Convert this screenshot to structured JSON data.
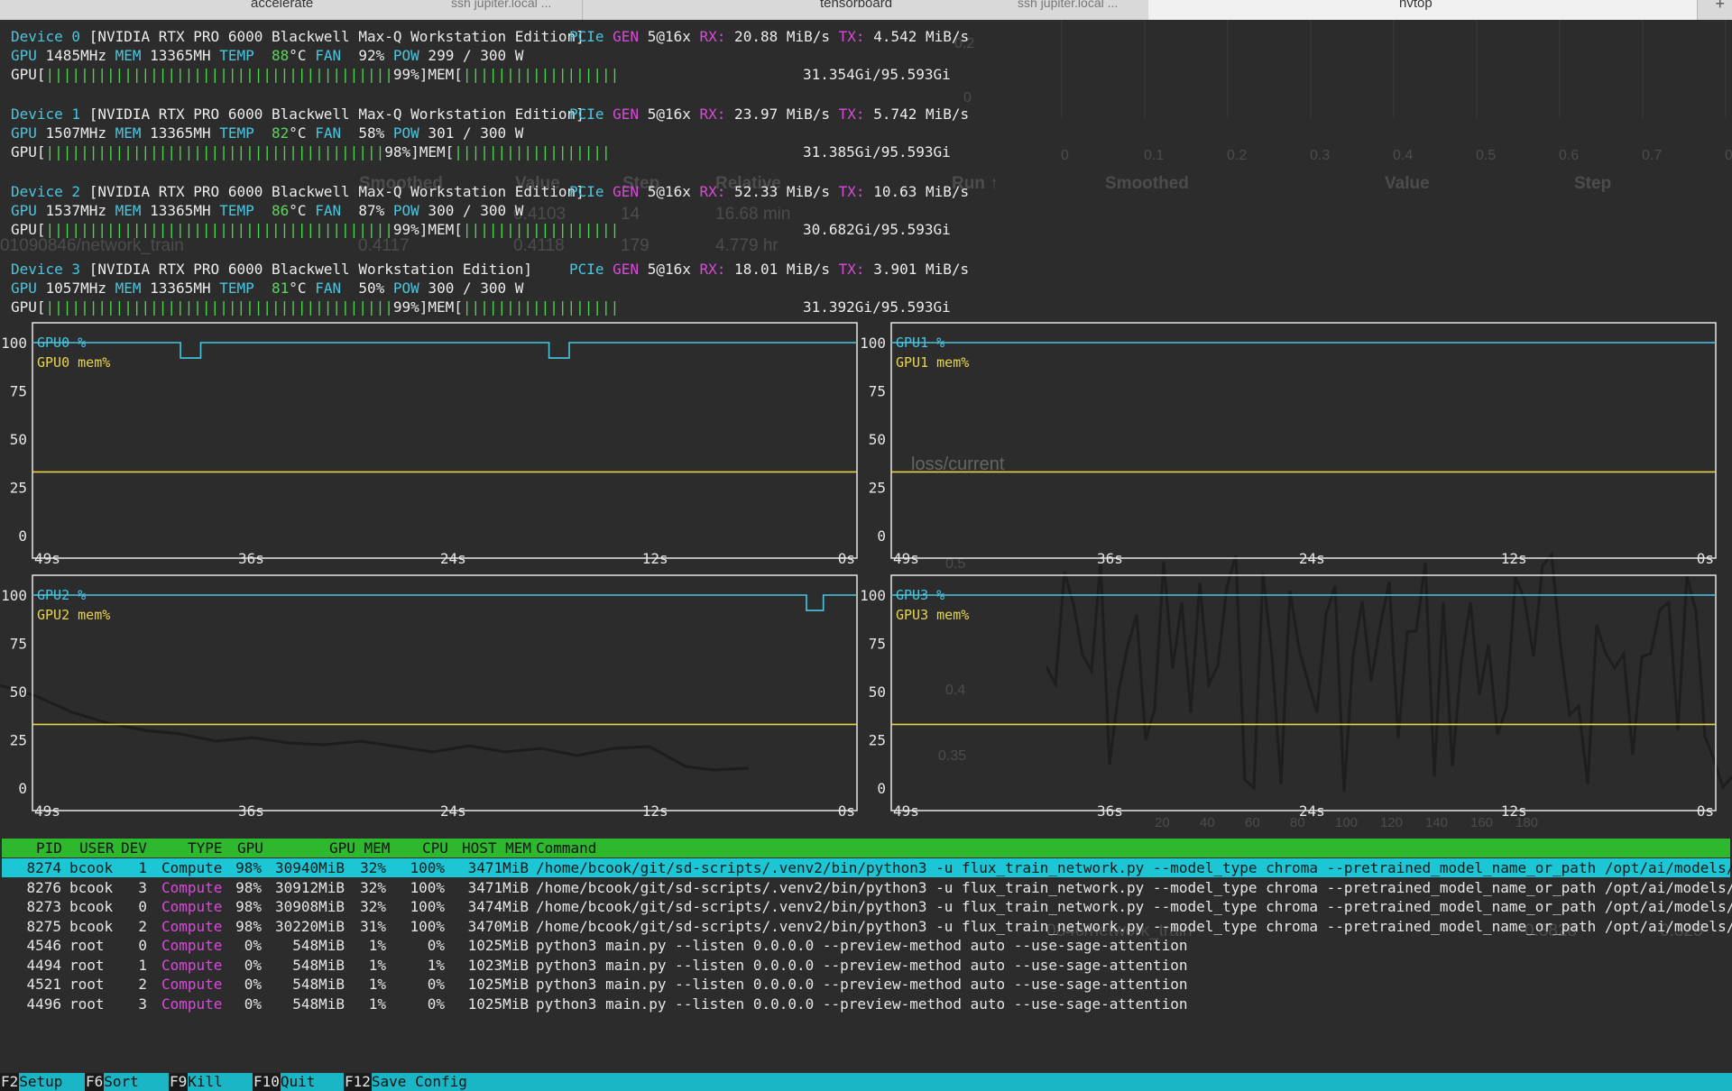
{
  "tabs": [
    {
      "title": "accelerate",
      "sub": "ssh jupiter.local ..."
    },
    {
      "title": "tensorboard",
      "sub": "ssh jupiter.local ..."
    },
    {
      "title": "nvtop",
      "sub": ""
    }
  ],
  "tab_plus": "+",
  "devices": [
    {
      "header": "Device 0",
      "name": "[NVIDIA RTX PRO 6000 Blackwell Max-Q Workstation Edition]",
      "pcie_gen": "5@16x",
      "rx": "20.88 MiB/s",
      "tx": "4.542 MiB/s",
      "gpu_clock": "1485MHz",
      "mem_clock": "13365MH",
      "temp": "88",
      "fan": "92%",
      "pow": "299 / 300 W",
      "util": "99%",
      "mem": "31.354Gi/95.593Gi"
    },
    {
      "header": "Device 1",
      "name": "[NVIDIA RTX PRO 6000 Blackwell Max-Q Workstation Edition]",
      "pcie_gen": "5@16x",
      "rx": "23.97 MiB/s",
      "tx": "5.742 MiB/s",
      "gpu_clock": "1507MHz",
      "mem_clock": "13365MH",
      "temp": "82",
      "fan": "58%",
      "pow": "301 / 300 W",
      "util": "98%",
      "mem": "31.385Gi/95.593Gi"
    },
    {
      "header": "Device 2",
      "name": "[NVIDIA RTX PRO 6000 Blackwell Max-Q Workstation Edition]",
      "pcie_gen": "5@16x",
      "rx": "52.33 MiB/s",
      "tx": "10.63 MiB/s",
      "gpu_clock": "1537MHz",
      "mem_clock": "13365MH",
      "temp": "86",
      "fan": "87%",
      "pow": "300 / 300 W",
      "util": "99%",
      "mem": "30.682Gi/95.593Gi"
    },
    {
      "header": "Device 3",
      "name": "[NVIDIA RTX PRO 6000 Blackwell Workstation Edition]",
      "pcie_gen": "5@16x",
      "rx": "18.01 MiB/s",
      "tx": "3.901 MiB/s",
      "gpu_clock": "1057MHz",
      "mem_clock": "13365MH",
      "temp": "81",
      "fan": "50%",
      "pow": "300 / 300 W",
      "util": "99%",
      "mem": "31.392Gi/95.593Gi"
    }
  ],
  "labels": {
    "pcie": "PCIe",
    "gen": "GEN",
    "rx": "RX:",
    "tx": "TX:",
    "gpu": "GPU",
    "mem": "MEM",
    "temp": "TEMP",
    "deg": "°C",
    "fan": "FAN",
    "pow": "POW",
    "gpu_bar_prefix": "GPU[",
    "mem_bar_prefix": "MEM[",
    "bar_suffix": "]"
  },
  "chart_data": [
    {
      "type": "line",
      "title": "",
      "legend": [
        "GPU0 %",
        "GPU0 mem%"
      ],
      "y_ticks": [
        "100",
        "75",
        "50",
        "25",
        "0"
      ],
      "x_ticks": [
        "49s",
        "36s",
        "24s",
        "12s",
        "0s"
      ],
      "ylim": [
        0,
        100
      ],
      "series": [
        {
          "name": "GPU0 %",
          "color": "#48c6e0",
          "x": [
            49,
            40.2,
            40.2,
            39,
            39,
            18.3,
            18.3,
            17.1,
            17.1,
            0
          ],
          "values": [
            100,
            100,
            92,
            92,
            100,
            100,
            92,
            92,
            100,
            100
          ]
        },
        {
          "name": "GPU0 mem%",
          "color": "#e8d44d",
          "x": [
            49,
            0
          ],
          "values": [
            33,
            33
          ]
        }
      ]
    },
    {
      "type": "line",
      "title": "",
      "legend": [
        "GPU1 %",
        "GPU1 mem%"
      ],
      "y_ticks": [
        "100",
        "75",
        "50",
        "25",
        "0"
      ],
      "x_ticks": [
        "49s",
        "36s",
        "24s",
        "12s",
        "0s"
      ],
      "ylim": [
        0,
        100
      ],
      "series": [
        {
          "name": "GPU1 %",
          "color": "#48c6e0",
          "x": [
            49,
            0
          ],
          "values": [
            100,
            100
          ]
        },
        {
          "name": "GPU1 mem%",
          "color": "#e8d44d",
          "x": [
            49,
            0
          ],
          "values": [
            33,
            33
          ]
        }
      ]
    },
    {
      "type": "line",
      "title": "",
      "legend": [
        "GPU2 %",
        "GPU2 mem%"
      ],
      "y_ticks": [
        "100",
        "75",
        "50",
        "25",
        "0"
      ],
      "x_ticks": [
        "49s",
        "36s",
        "24s",
        "12s",
        "0s"
      ],
      "ylim": [
        0,
        100
      ],
      "series": [
        {
          "name": "GPU2 %",
          "color": "#48c6e0",
          "x": [
            49,
            3,
            3,
            2,
            2,
            0
          ],
          "values": [
            100,
            100,
            92,
            92,
            100,
            100
          ]
        },
        {
          "name": "GPU2 mem%",
          "color": "#e8d44d",
          "x": [
            49,
            0
          ],
          "values": [
            33,
            33
          ]
        }
      ]
    },
    {
      "type": "line",
      "title": "",
      "legend": [
        "GPU3 %",
        "GPU3 mem%"
      ],
      "y_ticks": [
        "100",
        "75",
        "50",
        "25",
        "0"
      ],
      "x_ticks": [
        "49s",
        "36s",
        "24s",
        "12s",
        "0s"
      ],
      "ylim": [
        0,
        100
      ],
      "series": [
        {
          "name": "GPU3 %",
          "color": "#48c6e0",
          "x": [
            49,
            0
          ],
          "values": [
            100,
            100
          ]
        },
        {
          "name": "GPU3 mem%",
          "color": "#e8d44d",
          "x": [
            49,
            0
          ],
          "values": [
            33,
            33
          ]
        }
      ]
    }
  ],
  "process_table": {
    "headers": [
      "PID",
      "USER",
      "DEV",
      "TYPE",
      "GPU",
      "GPU MEM",
      "CPU",
      "HOST MEM",
      "Command"
    ],
    "rows": [
      [
        "8274",
        "bcook",
        "1",
        "Compute",
        "98%",
        "30940MiB",
        "32%",
        "100%",
        "3471MiB",
        "/home/bcook/git/sd-scripts/.venv2/bin/python3 -u flux_train_network.py --model_type chroma --pretrained_model_name_or_path /opt/ai/models/comfy"
      ],
      [
        "8276",
        "bcook",
        "3",
        "Compute",
        "98%",
        "30912MiB",
        "32%",
        "100%",
        "3471MiB",
        "/home/bcook/git/sd-scripts/.venv2/bin/python3 -u flux_train_network.py --model_type chroma --pretrained_model_name_or_path /opt/ai/models/comfy"
      ],
      [
        "8273",
        "bcook",
        "0",
        "Compute",
        "98%",
        "30908MiB",
        "32%",
        "100%",
        "3474MiB",
        "/home/bcook/git/sd-scripts/.venv2/bin/python3 -u flux_train_network.py --model_type chroma --pretrained_model_name_or_path /opt/ai/models/comfy"
      ],
      [
        "8275",
        "bcook",
        "2",
        "Compute",
        "98%",
        "30220MiB",
        "31%",
        "100%",
        "3470MiB",
        "/home/bcook/git/sd-scripts/.venv2/bin/python3 -u flux_train_network.py --model_type chroma --pretrained_model_name_or_path /opt/ai/models/comfy"
      ],
      [
        "4546",
        "root",
        "0",
        "Compute",
        "0%",
        "548MiB",
        "1%",
        "0%",
        "1025MiB",
        "python3 main.py --listen 0.0.0.0 --preview-method auto --use-sage-attention"
      ],
      [
        "4494",
        "root",
        "1",
        "Compute",
        "0%",
        "548MiB",
        "1%",
        "1%",
        "1023MiB",
        "python3 main.py --listen 0.0.0.0 --preview-method auto --use-sage-attention"
      ],
      [
        "4521",
        "root",
        "2",
        "Compute",
        "0%",
        "548MiB",
        "1%",
        "0%",
        "1025MiB",
        "python3 main.py --listen 0.0.0.0 --preview-method auto --use-sage-attention"
      ],
      [
        "4496",
        "root",
        "3",
        "Compute",
        "0%",
        "548MiB",
        "1%",
        "0%",
        "1025MiB",
        "python3 main.py --listen 0.0.0.0 --preview-method auto --use-sage-attention"
      ]
    ]
  },
  "footer": [
    {
      "key": "F2",
      "label": "Setup"
    },
    {
      "key": "F6",
      "label": "Sort"
    },
    {
      "key": "F9",
      "label": "Kill"
    },
    {
      "key": "F10",
      "label": "Quit"
    },
    {
      "key": "F12",
      "label": "Save Config"
    }
  ],
  "ghost": {
    "loss_title": "loss/current",
    "run": "Run ↑",
    "smoothed": "Smoothed",
    "value": "Value",
    "step": "Step",
    "relative": "Relative",
    "train1": "01090846/network_train",
    "train2": "0.4117",
    "train3": "0.4118",
    "train4": "179",
    "train5": "4.779 hr",
    "v1": "0.4103",
    "v2": "14",
    "v3": "16.68 min",
    "axis1": [
      "0",
      "0.1",
      "0.2",
      "0.3",
      "0.4",
      "0.5",
      "0.6",
      "0.7",
      "0.8"
    ],
    "yax1": [
      "0.2",
      "0"
    ],
    "axis2": [
      "20",
      "40",
      "60",
      "80",
      "100",
      "120",
      "140",
      "160",
      "180"
    ],
    "yax2": [
      "0.5",
      "0.4",
      "0.35"
    ],
    "train_b": "0846/network_train",
    "b1": "0.3828",
    "b2": "0.325"
  }
}
